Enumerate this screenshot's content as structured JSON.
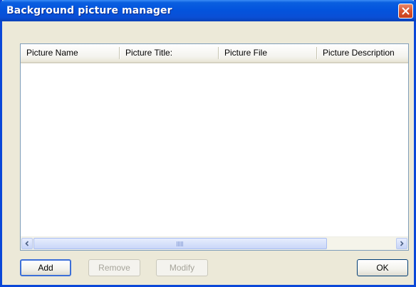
{
  "window": {
    "title": "Background picture manager",
    "close_icon": "close-icon"
  },
  "listview": {
    "columns": [
      "Picture Name",
      "Picture Title:",
      "Picture File",
      "Picture Description"
    ],
    "rows": []
  },
  "scrollbar": {
    "left_icon": "chevron-left-icon",
    "right_icon": "chevron-right-icon"
  },
  "buttons": {
    "add": "Add",
    "remove": "Remove",
    "modify": "Modify",
    "ok": "OK"
  },
  "colors": {
    "titlebar": "#0354dd",
    "close": "#d9532d",
    "border": "#0a47d8"
  }
}
